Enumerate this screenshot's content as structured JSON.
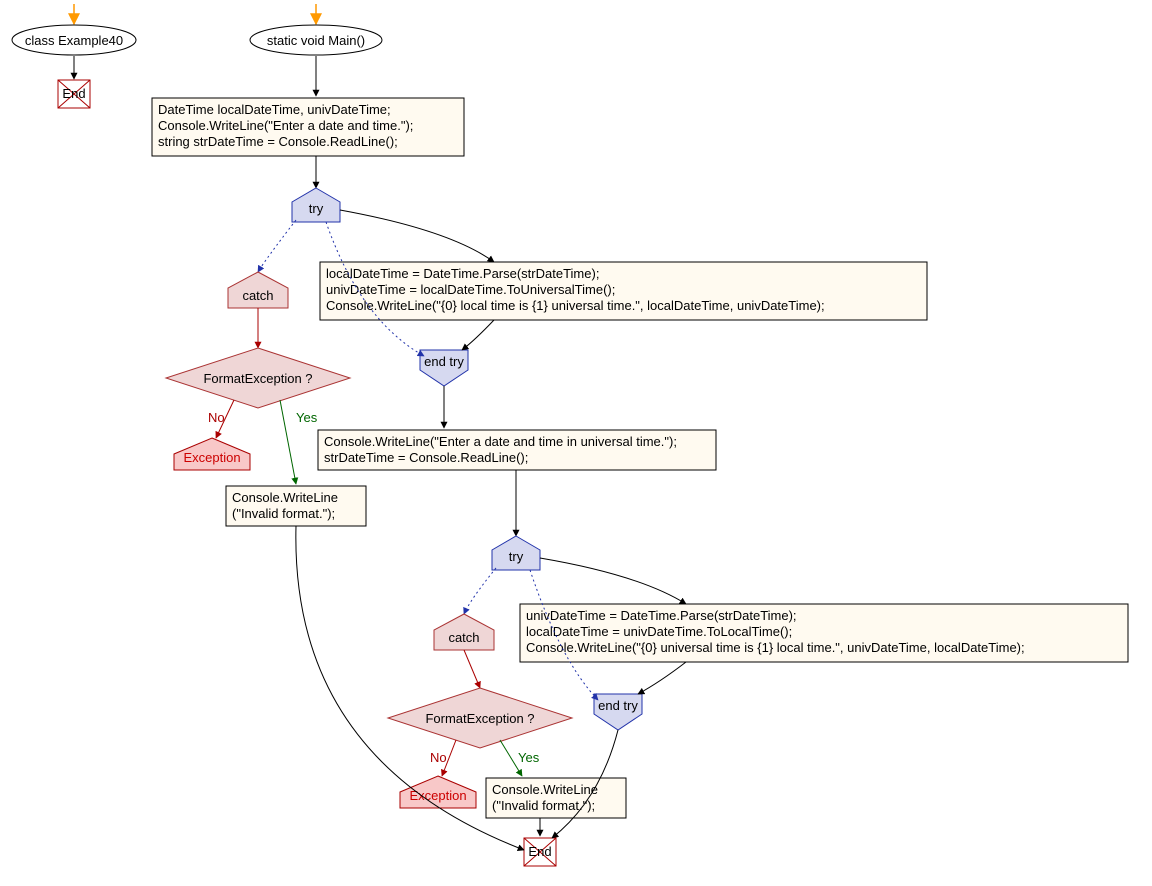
{
  "nodes": {
    "classLabel": "class Example40",
    "mainLabel": "static void Main()",
    "block1_l1": "DateTime localDateTime, univDateTime;",
    "block1_l2": "Console.WriteLine(\"Enter a date and time.\");",
    "block1_l3": "string strDateTime = Console.ReadLine();",
    "try1": "try",
    "tryBody1_l1": "localDateTime = DateTime.Parse(strDateTime);",
    "tryBody1_l2": "univDateTime = localDateTime.ToUniversalTime();",
    "tryBody1_l3": "Console.WriteLine(\"{0} local time is {1} universal time.\", localDateTime, univDateTime);",
    "catch1": "catch",
    "decision1": "FormatException ?",
    "exception1": "Exception",
    "catchBody1_l1": "Console.WriteLine",
    "catchBody1_l2": "(\"Invalid format.\");",
    "endtry1": "end try",
    "block2_l1": "Console.WriteLine(\"Enter a date and time in universal time.\");",
    "block2_l2": "strDateTime = Console.ReadLine();",
    "try2": "try",
    "tryBody2_l1": "univDateTime = DateTime.Parse(strDateTime);",
    "tryBody2_l2": "localDateTime = univDateTime.ToLocalTime();",
    "tryBody2_l3": "Console.WriteLine(\"{0} universal time is {1} local time.\", univDateTime, localDateTime);",
    "catch2": "catch",
    "decision2": "FormatException ?",
    "exception2": "Exception",
    "catchBody2_l1": "Console.WriteLine",
    "catchBody2_l2": "(\"Invalid format.\");",
    "endtry2": "end try",
    "end1": "End",
    "end2": "End",
    "no": "No",
    "yes": "Yes"
  }
}
